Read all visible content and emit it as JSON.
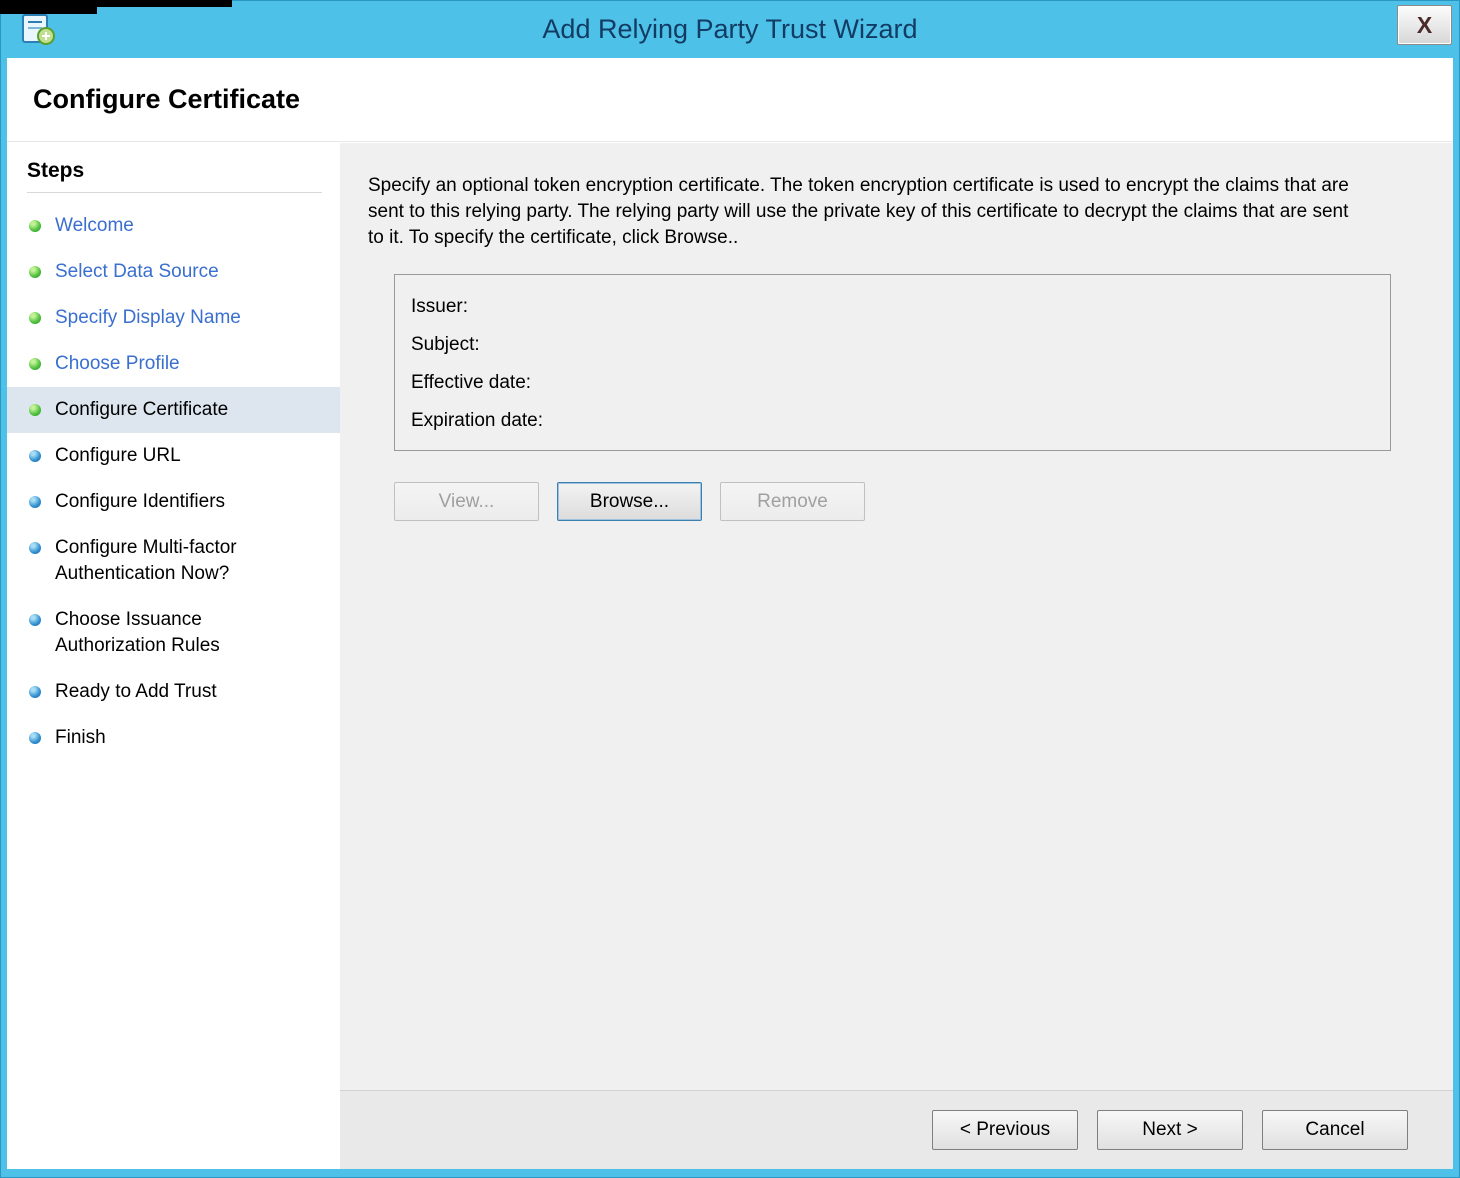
{
  "colors": {
    "titlebar_blue": "#4ec1e8",
    "title_text": "#123c63",
    "link_blue": "#3a6fd0",
    "step_current_bg": "#dde5ee",
    "bullet_completed_green": "#4cbf3c",
    "bullet_upcoming_blue": "#2f8fd0",
    "main_bg": "#f0f0f0"
  },
  "window": {
    "title": "Add Relying Party Trust Wizard",
    "close_label": "X"
  },
  "page": {
    "title": "Configure Certificate"
  },
  "sidebar": {
    "heading": "Steps",
    "items": [
      {
        "label": "Welcome",
        "state": "completed"
      },
      {
        "label": "Select Data Source",
        "state": "completed"
      },
      {
        "label": "Specify Display Name",
        "state": "completed"
      },
      {
        "label": "Choose Profile",
        "state": "completed"
      },
      {
        "label": "Configure Certificate",
        "state": "current"
      },
      {
        "label": "Configure URL",
        "state": "upcoming"
      },
      {
        "label": "Configure Identifiers",
        "state": "upcoming"
      },
      {
        "label": "Configure Multi-factor Authentication Now?",
        "state": "upcoming"
      },
      {
        "label": "Choose Issuance Authorization Rules",
        "state": "upcoming"
      },
      {
        "label": "Ready to Add Trust",
        "state": "upcoming"
      },
      {
        "label": "Finish",
        "state": "upcoming"
      }
    ]
  },
  "content": {
    "description": "Specify an optional token encryption certificate.  The token encryption certificate is used to encrypt the claims that are sent to this relying party.  The relying party will use the private key of this certificate to decrypt the claims that are sent to it.  To specify the certificate, click Browse..",
    "certificate_fields": [
      {
        "label": "Issuer:",
        "value": ""
      },
      {
        "label": "Subject:",
        "value": ""
      },
      {
        "label": "Effective date:",
        "value": ""
      },
      {
        "label": "Expiration date:",
        "value": ""
      }
    ],
    "buttons": {
      "view": "View...",
      "browse": "Browse...",
      "remove": "Remove"
    }
  },
  "footer": {
    "previous": "< Previous",
    "next": "Next >",
    "cancel": "Cancel"
  }
}
